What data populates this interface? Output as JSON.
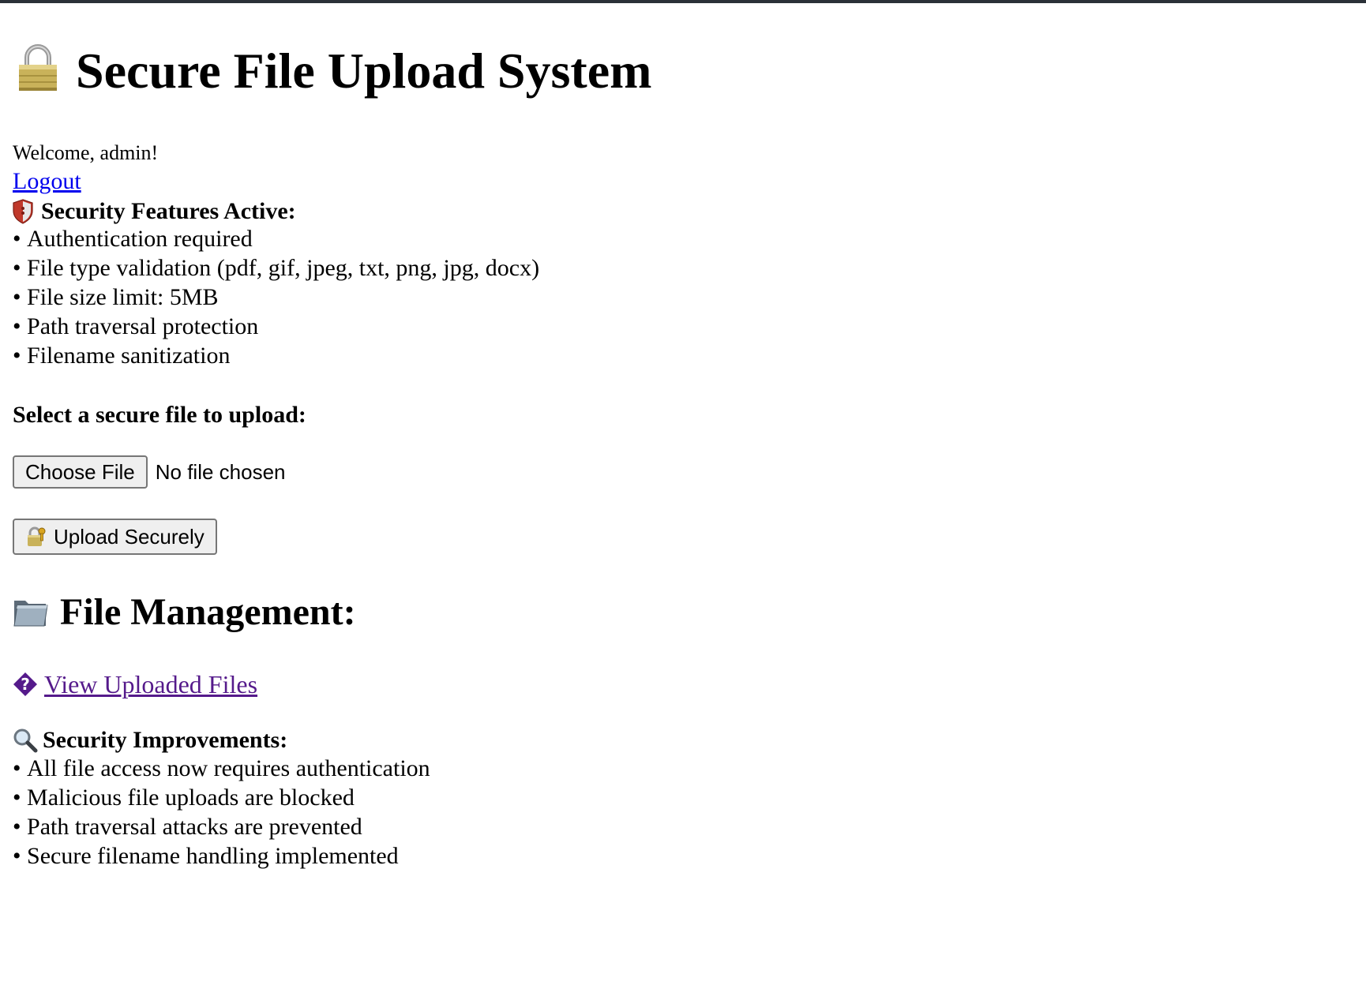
{
  "header": {
    "title": "Secure File Upload System",
    "icon": "lock-icon"
  },
  "user": {
    "welcome": "Welcome, admin!",
    "logout_label": "Logout"
  },
  "security_features": {
    "heading": "Security Features Active:",
    "icon": "shield-icon",
    "items": [
      "Authentication required",
      "File type validation (pdf, gif, jpeg, txt, png, jpg, docx)",
      "File size limit: 5MB",
      "Path traversal protection",
      "Filename sanitization"
    ]
  },
  "upload": {
    "label": "Select a secure file to upload:",
    "choose_button": "Choose File",
    "file_status": "No file chosen",
    "submit_button": "Upload Securely",
    "submit_icon": "lock-with-key-icon"
  },
  "file_management": {
    "heading": "File Management:",
    "icon": "folder-icon",
    "view_link": "View Uploaded Files",
    "view_link_icon": "replacement-character-icon"
  },
  "security_improvements": {
    "heading": "Security Improvements:",
    "icon": "magnifier-icon",
    "items": [
      "All file access now requires authentication",
      "Malicious file uploads are blocked",
      "Path traversal attacks are prevented",
      "Secure filename handling implemented"
    ]
  },
  "colors": {
    "link": "#0000ee",
    "visited_link": "#551a8b",
    "button_bg": "#efefef",
    "top_strip": "#2b3138"
  }
}
